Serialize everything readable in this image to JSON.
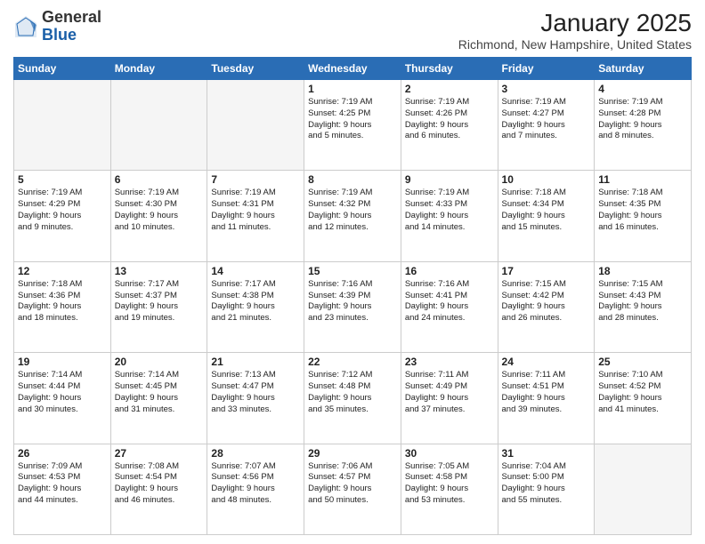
{
  "header": {
    "logo_general": "General",
    "logo_blue": "Blue",
    "month_title": "January 2025",
    "location": "Richmond, New Hampshire, United States"
  },
  "days_of_week": [
    "Sunday",
    "Monday",
    "Tuesday",
    "Wednesday",
    "Thursday",
    "Friday",
    "Saturday"
  ],
  "weeks": [
    [
      {
        "day": "",
        "info": ""
      },
      {
        "day": "",
        "info": ""
      },
      {
        "day": "",
        "info": ""
      },
      {
        "day": "1",
        "info": "Sunrise: 7:19 AM\nSunset: 4:25 PM\nDaylight: 9 hours\nand 5 minutes."
      },
      {
        "day": "2",
        "info": "Sunrise: 7:19 AM\nSunset: 4:26 PM\nDaylight: 9 hours\nand 6 minutes."
      },
      {
        "day": "3",
        "info": "Sunrise: 7:19 AM\nSunset: 4:27 PM\nDaylight: 9 hours\nand 7 minutes."
      },
      {
        "day": "4",
        "info": "Sunrise: 7:19 AM\nSunset: 4:28 PM\nDaylight: 9 hours\nand 8 minutes."
      }
    ],
    [
      {
        "day": "5",
        "info": "Sunrise: 7:19 AM\nSunset: 4:29 PM\nDaylight: 9 hours\nand 9 minutes."
      },
      {
        "day": "6",
        "info": "Sunrise: 7:19 AM\nSunset: 4:30 PM\nDaylight: 9 hours\nand 10 minutes."
      },
      {
        "day": "7",
        "info": "Sunrise: 7:19 AM\nSunset: 4:31 PM\nDaylight: 9 hours\nand 11 minutes."
      },
      {
        "day": "8",
        "info": "Sunrise: 7:19 AM\nSunset: 4:32 PM\nDaylight: 9 hours\nand 12 minutes."
      },
      {
        "day": "9",
        "info": "Sunrise: 7:19 AM\nSunset: 4:33 PM\nDaylight: 9 hours\nand 14 minutes."
      },
      {
        "day": "10",
        "info": "Sunrise: 7:18 AM\nSunset: 4:34 PM\nDaylight: 9 hours\nand 15 minutes."
      },
      {
        "day": "11",
        "info": "Sunrise: 7:18 AM\nSunset: 4:35 PM\nDaylight: 9 hours\nand 16 minutes."
      }
    ],
    [
      {
        "day": "12",
        "info": "Sunrise: 7:18 AM\nSunset: 4:36 PM\nDaylight: 9 hours\nand 18 minutes."
      },
      {
        "day": "13",
        "info": "Sunrise: 7:17 AM\nSunset: 4:37 PM\nDaylight: 9 hours\nand 19 minutes."
      },
      {
        "day": "14",
        "info": "Sunrise: 7:17 AM\nSunset: 4:38 PM\nDaylight: 9 hours\nand 21 minutes."
      },
      {
        "day": "15",
        "info": "Sunrise: 7:16 AM\nSunset: 4:39 PM\nDaylight: 9 hours\nand 23 minutes."
      },
      {
        "day": "16",
        "info": "Sunrise: 7:16 AM\nSunset: 4:41 PM\nDaylight: 9 hours\nand 24 minutes."
      },
      {
        "day": "17",
        "info": "Sunrise: 7:15 AM\nSunset: 4:42 PM\nDaylight: 9 hours\nand 26 minutes."
      },
      {
        "day": "18",
        "info": "Sunrise: 7:15 AM\nSunset: 4:43 PM\nDaylight: 9 hours\nand 28 minutes."
      }
    ],
    [
      {
        "day": "19",
        "info": "Sunrise: 7:14 AM\nSunset: 4:44 PM\nDaylight: 9 hours\nand 30 minutes."
      },
      {
        "day": "20",
        "info": "Sunrise: 7:14 AM\nSunset: 4:45 PM\nDaylight: 9 hours\nand 31 minutes."
      },
      {
        "day": "21",
        "info": "Sunrise: 7:13 AM\nSunset: 4:47 PM\nDaylight: 9 hours\nand 33 minutes."
      },
      {
        "day": "22",
        "info": "Sunrise: 7:12 AM\nSunset: 4:48 PM\nDaylight: 9 hours\nand 35 minutes."
      },
      {
        "day": "23",
        "info": "Sunrise: 7:11 AM\nSunset: 4:49 PM\nDaylight: 9 hours\nand 37 minutes."
      },
      {
        "day": "24",
        "info": "Sunrise: 7:11 AM\nSunset: 4:51 PM\nDaylight: 9 hours\nand 39 minutes."
      },
      {
        "day": "25",
        "info": "Sunrise: 7:10 AM\nSunset: 4:52 PM\nDaylight: 9 hours\nand 41 minutes."
      }
    ],
    [
      {
        "day": "26",
        "info": "Sunrise: 7:09 AM\nSunset: 4:53 PM\nDaylight: 9 hours\nand 44 minutes."
      },
      {
        "day": "27",
        "info": "Sunrise: 7:08 AM\nSunset: 4:54 PM\nDaylight: 9 hours\nand 46 minutes."
      },
      {
        "day": "28",
        "info": "Sunrise: 7:07 AM\nSunset: 4:56 PM\nDaylight: 9 hours\nand 48 minutes."
      },
      {
        "day": "29",
        "info": "Sunrise: 7:06 AM\nSunset: 4:57 PM\nDaylight: 9 hours\nand 50 minutes."
      },
      {
        "day": "30",
        "info": "Sunrise: 7:05 AM\nSunset: 4:58 PM\nDaylight: 9 hours\nand 53 minutes."
      },
      {
        "day": "31",
        "info": "Sunrise: 7:04 AM\nSunset: 5:00 PM\nDaylight: 9 hours\nand 55 minutes."
      },
      {
        "day": "",
        "info": ""
      }
    ]
  ]
}
